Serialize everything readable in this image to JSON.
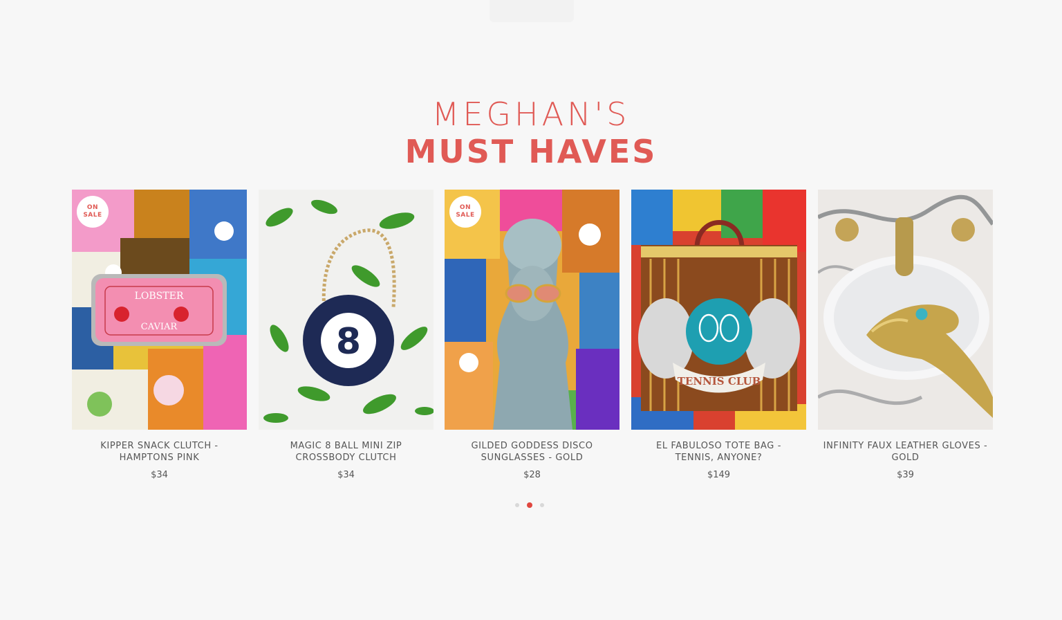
{
  "heading": {
    "line1": "MEGHAN'S",
    "line2": "MUST HAVES"
  },
  "badge": {
    "line1": "ON",
    "line2": "SALE"
  },
  "products": [
    {
      "title": "KIPPER SNACK CLUTCH - HAMPTONS PINK",
      "price": "$34",
      "on_sale": true,
      "tin_lines": [
        "LOBSTER",
        "CAVIAR"
      ]
    },
    {
      "title": "MAGIC 8 BALL MINI ZIP CROSSBODY CLUTCH",
      "price": "$34",
      "on_sale": false,
      "ball_number": "8"
    },
    {
      "title": "GILDED GODDESS DISCO SUNGLASSES - GOLD",
      "price": "$28",
      "on_sale": true
    },
    {
      "title": "EL FABULOSO TOTE BAG - TENNIS, ANYONE?",
      "price": "$149",
      "on_sale": false,
      "patch_text": "TENNIS CLUB"
    },
    {
      "title": "INFINITY FAUX LEATHER GLOVES - GOLD",
      "price": "$39",
      "on_sale": false
    }
  ],
  "pagination": {
    "count": 3,
    "active_index": 1
  },
  "colors": {
    "accent": "#e05a55",
    "background": "#f7f7f7",
    "text": "#555555",
    "dot_active": "#e0473f"
  }
}
